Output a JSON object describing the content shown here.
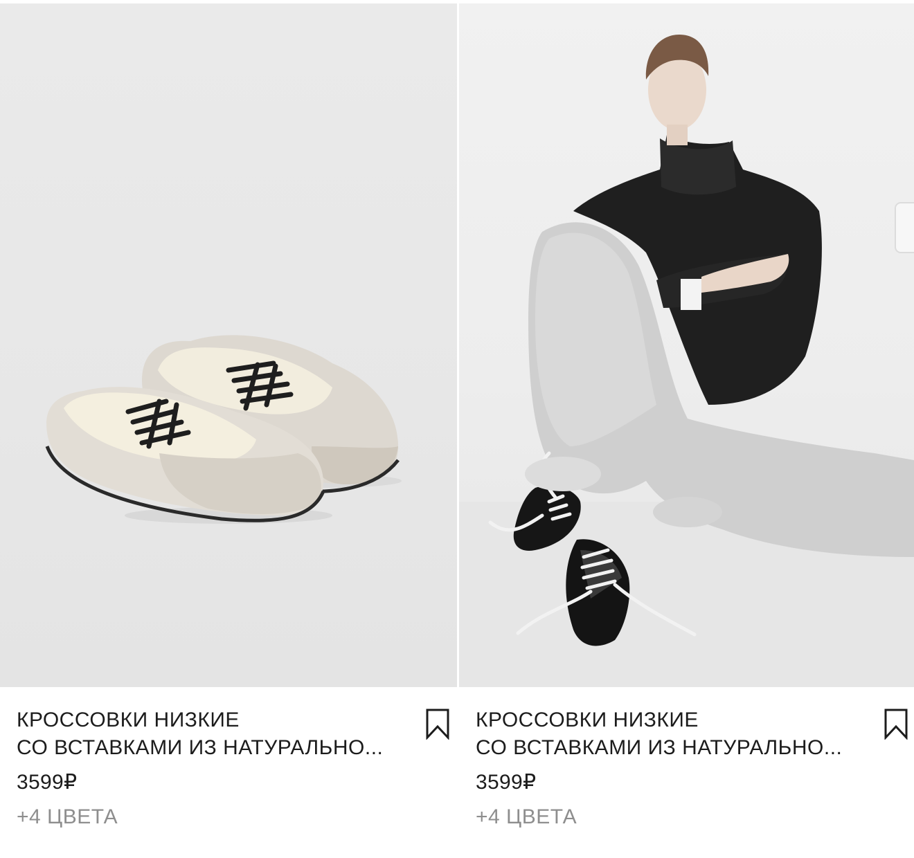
{
  "products": [
    {
      "title_line1": "КРОССОВКИ НИЗКИЕ",
      "title_line2": "СО ВСТАВКАМИ ИЗ НАТУРАЛЬНО...",
      "price": "3599₽",
      "colors": "+4 ЦВЕТА",
      "bookmark_icon": "bookmark-outline-icon",
      "image": "product-photo-sneakers"
    },
    {
      "title_line1": "КРОССОВКИ НИЗКИЕ",
      "title_line2": "СО ВСТАВКАМИ ИЗ НАТУРАЛЬНО...",
      "price": "3599₽",
      "colors": "+4 ЦВЕТА",
      "bookmark_icon": "bookmark-outline-icon",
      "image": "model-photo-sneakers"
    }
  ],
  "colors": {
    "text": "#1c1c1c",
    "muted": "#8e8e8e",
    "background": "#ffffff"
  }
}
